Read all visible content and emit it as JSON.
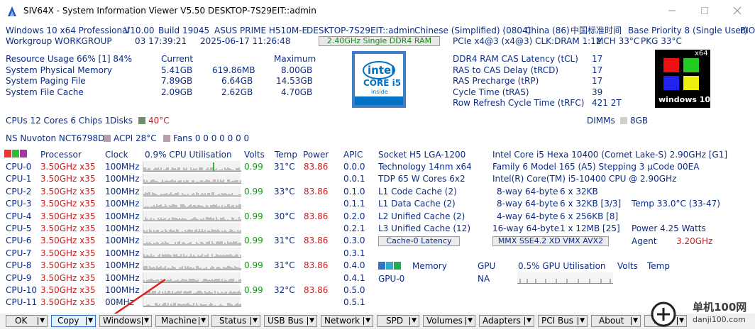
{
  "window": {
    "title": "SIV64X - System Information Viewer V5.50 DESKTOP-7S29EIT::admin",
    "icon": "siv-app-icon",
    "controls": [
      "minimize",
      "maximize",
      "close"
    ]
  },
  "header": {
    "row1": [
      "Windows 10 x64 Professional",
      "V10.00",
      "Build 19045",
      "ASUS PRIME H510M-E",
      "DESKTOP-7S29EIT::admin",
      "Chinese (Simplified) (0804)",
      "China (86)",
      "中国标准时间",
      "Base Priority 8 (Single User)",
      "BIO"
    ],
    "row2": [
      "Workgroup WORKGROUP",
      "03 17:39:21",
      "2025-06-17 11:26:48",
      "2.40GHz Single DDR4 RAM",
      "PCIe x4@3 (x4@3) CLK:DRAM 1:12",
      "MCH 33°C",
      "PKG 33°C"
    ]
  },
  "memory": {
    "resource_usage": "Resource Usage 66% [1] 84%",
    "col_current": "Current",
    "col_maximum": "Maximum",
    "rows": [
      {
        "label": "System Physical Memory",
        "current": "5.41GB",
        "middle": "619.86MB",
        "maximum": "8.00GB"
      },
      {
        "label": "System Paging File",
        "current": "7.89GB",
        "middle": "6.64GB",
        "maximum": "14.53GB"
      },
      {
        "label": "System File Cache",
        "current": "2.09GB",
        "middle": "2.62GB",
        "maximum": "4.70GB"
      }
    ]
  },
  "intel_badge": {
    "brand": "intel",
    "line1": "CORE i5",
    "line2": "inside"
  },
  "dram_timings": [
    {
      "label": "DDR4 RAM CAS Latency (tCL)",
      "value": "17"
    },
    {
      "label": "RAS to CAS Delay (tRCD)",
      "value": "17"
    },
    {
      "label": "RAS Precharge (tRP)",
      "value": "17"
    },
    {
      "label": "Cycle Time (tRAS)",
      "value": "39"
    },
    {
      "label": "Row Refresh Cycle Time (tRFC)",
      "value": "421 2T"
    }
  ],
  "windows_logo": {
    "badge": "x64",
    "label": "windows 10"
  },
  "summary": {
    "cpus": "CPUs 12 Cores 6 Chips 1",
    "disks_label": "Disks",
    "disks_temp": "40°C",
    "dimms_label": "DIMMs",
    "dimms_value": "8GB",
    "sensor": "NS Nuvoton NCT6798D",
    "acpi": "ACPI 28°C",
    "fans": "Fans 0 0 0 0 0 0 0"
  },
  "cpu_table": {
    "headers": {
      "processor": "Processor",
      "clock": "Clock",
      "util": "0.9% CPU Utilisation",
      "volts": "Volts",
      "temp": "Temp",
      "power": "Power",
      "apic": "APIC"
    },
    "rows": [
      {
        "name": "CPU-0",
        "freq": "3.50GHz x35",
        "clock": "100MHz",
        "volts": "0.99",
        "temp": "31°C",
        "power": "83.86",
        "apic": "0.0.0"
      },
      {
        "name": "CPU-1",
        "freq": "3.50GHz x35",
        "clock": "100MHz",
        "volts": "",
        "temp": "",
        "power": "",
        "apic": "0.0.1"
      },
      {
        "name": "CPU-2",
        "freq": "3.50GHz x35",
        "clock": "100MHz",
        "volts": "0.99",
        "temp": "33°C",
        "power": "83.86",
        "apic": "0.1.0"
      },
      {
        "name": "CPU-3",
        "freq": "3.50GHz x35",
        "clock": "100MHz",
        "volts": "",
        "temp": "",
        "power": "",
        "apic": "0.1.1"
      },
      {
        "name": "CPU-4",
        "freq": "3.50GHz x35",
        "clock": "100MHz",
        "volts": "0.99",
        "temp": "30°C",
        "power": "83.86",
        "apic": "0.2.0"
      },
      {
        "name": "CPU-5",
        "freq": "3.50GHz x35",
        "clock": "100MHz",
        "volts": "",
        "temp": "",
        "power": "",
        "apic": "0.2.1"
      },
      {
        "name": "CPU-6",
        "freq": "3.50GHz x35",
        "clock": "100MHz",
        "volts": "0.99",
        "temp": "31°C",
        "power": "83.86",
        "apic": "0.3.0"
      },
      {
        "name": "CPU-7",
        "freq": "3.50GHz x35",
        "clock": "100MHz",
        "volts": "",
        "temp": "",
        "power": "",
        "apic": "0.3.1"
      },
      {
        "name": "CPU-8",
        "freq": "3.50GHz x35",
        "clock": "100MHz",
        "volts": "0.99",
        "temp": "31°C",
        "power": "83.86",
        "apic": "0.4.0"
      },
      {
        "name": "CPU-9",
        "freq": "3.50GHz x35",
        "clock": "100MHz",
        "volts": "",
        "temp": "",
        "power": "",
        "apic": "0.4.1"
      },
      {
        "name": "CPU-10",
        "freq": "3.50GHz x35",
        "clock": "100MHz",
        "volts": "0.99",
        "temp": "32°C",
        "power": "83.86",
        "apic": "0.5.0"
      },
      {
        "name": "CPU-11",
        "freq": "3.50GHz x35",
        "clock": "00MHz",
        "volts": "",
        "temp": "",
        "power": "",
        "apic": "0.5.1"
      }
    ]
  },
  "socket_info": {
    "lines": [
      "Socket H5 LGA-1200",
      "Technology 14nm  x64",
      "TDP 65 W Cores 6x2",
      "L1 Code Cache (2)",
      "L1 Data Cache (2)",
      "L2 Unified Cache (2)",
      "L3 Unified Cache (12)"
    ],
    "latency_button": "Cache-0 Latency"
  },
  "cpu_info": {
    "lines": [
      "Intel Core i5 Hexa 10400 (Comet Lake-S) 2.90GHz [G1]",
      "Family 6  Model 165 (A5)  Stepping 3  μCode 00EA",
      "Intel(R) Core(TM) i5-10400 CPU @ 2.90GHz"
    ],
    "cache_rows": [
      {
        "assoc": "8-way 64-byte",
        "size": "6 x 32KB",
        "extra": ""
      },
      {
        "assoc": "8-way 64-byte",
        "size": "6 x 32KB [3/3]",
        "extra": "Temp   33.0°C (33-47)"
      },
      {
        "assoc": "4-way 64-byte",
        "size": "6 x 256KB [8]",
        "extra": ""
      },
      {
        "assoc": "16-way 64-byte",
        "size": "1 x 12MB [25]",
        "extra": "Power  4.25 Watts"
      }
    ],
    "features_button": "MMX SSE4.2 XD VMX AVX2",
    "agent_label": "Agent",
    "agent_value": "3.20GHz"
  },
  "gpu": {
    "memory": "Memory",
    "gpu": "GPU",
    "util": "0.5% GPU Utilisation",
    "volts": "Volts",
    "temp": "Temp",
    "name": "GPU-0",
    "value": "NA"
  },
  "bottom_buttons": [
    "OK",
    "Copy",
    "Windows",
    "Machine",
    "Status",
    "USB Bus",
    "Network",
    "SPD",
    "Volumes",
    "Adapters",
    "PCI Bus",
    "About",
    "Help"
  ],
  "watermark": {
    "site": "单机100网",
    "url": "danji100.com"
  },
  "colors": {
    "text": "#0c2d86",
    "red": "#c81e1e",
    "green": "#0aa00a",
    "arrow": "#e0201a"
  }
}
